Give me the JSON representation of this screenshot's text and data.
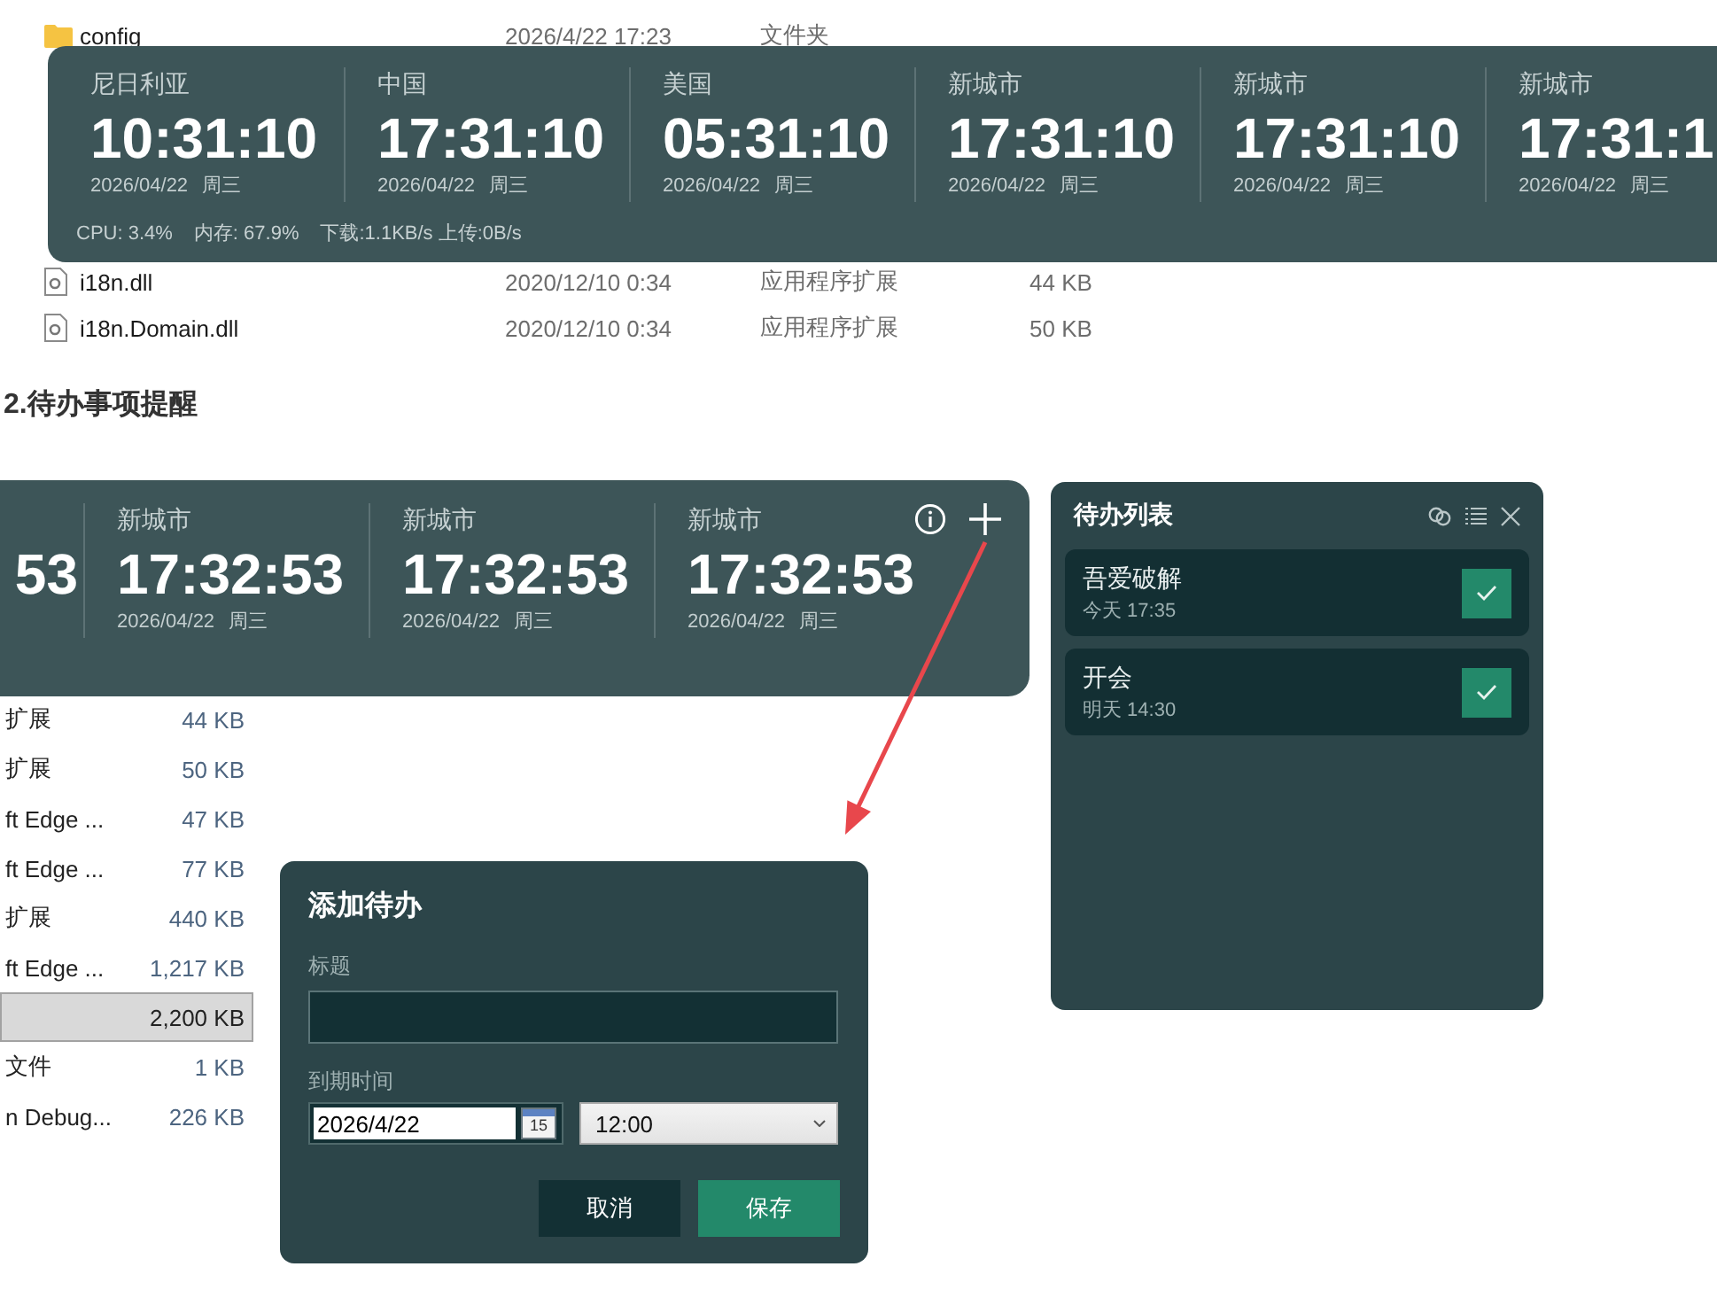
{
  "explorer_top": {
    "rows": [
      {
        "kind": "folder",
        "name": "config",
        "date": "2026/4/22 17:23",
        "type": "文件夹"
      }
    ]
  },
  "clock_widget": {
    "clocks": [
      {
        "city": "尼日利亚",
        "time": "10:31:10",
        "date": "2026/04/22",
        "weekday": "周三"
      },
      {
        "city": "中国",
        "time": "17:31:10",
        "date": "2026/04/22",
        "weekday": "周三"
      },
      {
        "city": "美国",
        "time": "05:31:10",
        "date": "2026/04/22",
        "weekday": "周三"
      },
      {
        "city": "新城市",
        "time": "17:31:10",
        "date": "2026/04/22",
        "weekday": "周三"
      },
      {
        "city": "新城市",
        "time": "17:31:10",
        "date": "2026/04/22",
        "weekday": "周三"
      },
      {
        "city": "新城市",
        "time": "17:31:1",
        "date": "2026/04/22",
        "weekday": "周三"
      }
    ],
    "stats": [
      "CPU: 3.4%",
      "内存: 67.9%",
      "下载:1.1KB/s 上传:0B/s"
    ]
  },
  "explorer_bottom": {
    "rows": [
      {
        "kind": "dll",
        "name": "i18n.dll",
        "date": "2020/12/10 0:34",
        "type": "应用程序扩展",
        "size": "44 KB"
      },
      {
        "kind": "dll",
        "name": "i18n.Domain.dll",
        "date": "2020/12/10 0:34",
        "type": "应用程序扩展",
        "size": "50 KB"
      }
    ]
  },
  "heading": "2.待办事项提醒",
  "clock_widget_2": {
    "clocks": [
      {
        "time": "53"
      },
      {
        "city": "新城市",
        "time": "17:32:53",
        "date": "2026/04/22",
        "weekday": "周三"
      },
      {
        "city": "新城市",
        "time": "17:32:53",
        "date": "2026/04/22",
        "weekday": "周三"
      },
      {
        "city": "新城市",
        "time": "17:32:53",
        "date": "2026/04/22",
        "weekday": "周三"
      }
    ]
  },
  "explorer_side": {
    "rows": [
      {
        "type": "扩展",
        "size": "44 KB",
        "selected": false
      },
      {
        "type": "扩展",
        "size": "50 KB",
        "selected": false
      },
      {
        "type": "ft Edge ...",
        "size": "47 KB",
        "selected": false
      },
      {
        "type": "ft Edge ...",
        "size": "77 KB",
        "selected": false
      },
      {
        "type": "扩展",
        "size": "440 KB",
        "selected": false
      },
      {
        "type": "ft Edge ...",
        "size": "1,217 KB",
        "selected": false
      },
      {
        "size": "2,200 KB",
        "selected": true
      },
      {
        "type": "文件",
        "size": "1 KB",
        "selected": false
      },
      {
        "type": "n Debug...",
        "size": "226 KB",
        "selected": false
      }
    ]
  },
  "todo_panel": {
    "title": "待办列表",
    "items": [
      {
        "title": "吾爱破解",
        "due": "今天 17:35"
      },
      {
        "title": "开会",
        "due": "明天 14:30"
      }
    ]
  },
  "dialog": {
    "title": "添加待办",
    "title_label": "标题",
    "due_label": "到期时间",
    "date_value": "2026/4/22",
    "calendar_day": "15",
    "time_value": "12:00",
    "buttons": [
      {
        "label": "取消",
        "kind": "secondary"
      },
      {
        "label": "保存",
        "kind": "primary"
      }
    ]
  }
}
